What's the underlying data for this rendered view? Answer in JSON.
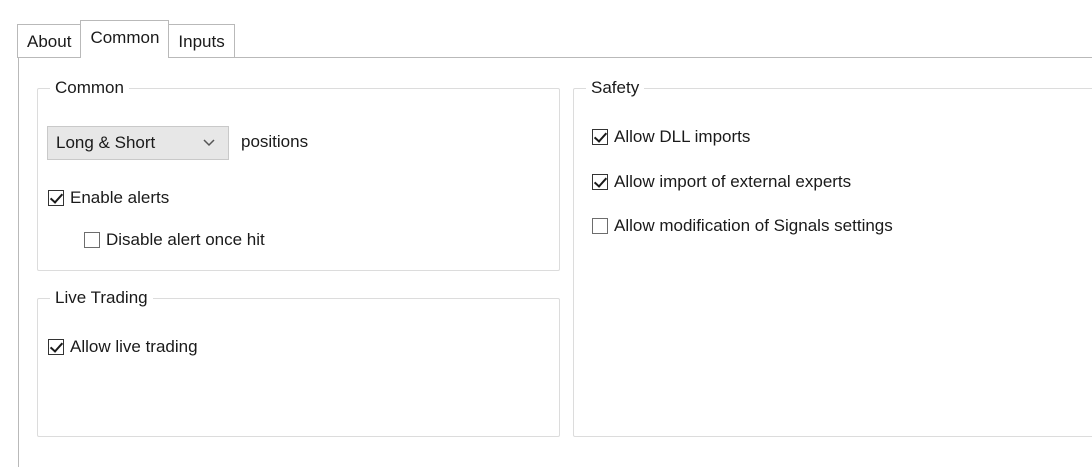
{
  "tabs": [
    {
      "label": "About",
      "active": false
    },
    {
      "label": "Common",
      "active": true
    },
    {
      "label": "Inputs",
      "active": false
    }
  ],
  "common_group": {
    "title": "Common",
    "positions_select": {
      "selected": "Long & Short",
      "icon": "chevron-down-icon"
    },
    "positions_label": "positions",
    "enable_alerts": {
      "label": "Enable alerts",
      "checked": true
    },
    "disable_alert_once_hit": {
      "label": "Disable alert once hit",
      "checked": false
    }
  },
  "live_trading_group": {
    "title": "Live Trading",
    "allow_live_trading": {
      "label": "Allow live trading",
      "checked": true
    }
  },
  "safety_group": {
    "title": "Safety",
    "allow_dll_imports": {
      "label": "Allow DLL imports",
      "checked": true
    },
    "allow_import_external_experts": {
      "label": "Allow import of external experts",
      "checked": true
    },
    "allow_modification_signals": {
      "label": "Allow modification of Signals settings",
      "checked": false
    }
  },
  "colors": {
    "border": "#b9b9b9",
    "group_border": "#dcdcdc",
    "dropdown_bg": "#e7e7e7"
  }
}
